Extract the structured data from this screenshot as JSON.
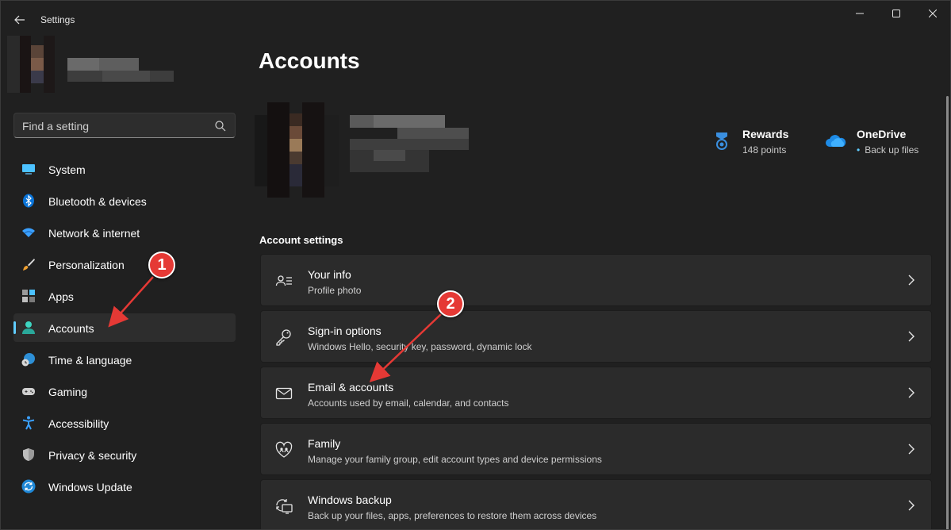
{
  "window": {
    "title": "Settings",
    "back_icon": "back-arrow-icon",
    "controls": [
      "minimize-icon",
      "maximize-icon",
      "close-icon"
    ]
  },
  "search": {
    "placeholder": "Find a setting",
    "icon": "search-icon"
  },
  "sidebar": {
    "items": [
      {
        "label": "System",
        "icon": "system-icon",
        "active": false
      },
      {
        "label": "Bluetooth & devices",
        "icon": "bluetooth-icon",
        "active": false
      },
      {
        "label": "Network & internet",
        "icon": "wifi-icon",
        "active": false
      },
      {
        "label": "Personalization",
        "icon": "brush-icon",
        "active": false
      },
      {
        "label": "Apps",
        "icon": "apps-icon",
        "active": false
      },
      {
        "label": "Accounts",
        "icon": "person-icon",
        "active": true
      },
      {
        "label": "Time & language",
        "icon": "globe-clock-icon",
        "active": false
      },
      {
        "label": "Gaming",
        "icon": "gamepad-icon",
        "active": false
      },
      {
        "label": "Accessibility",
        "icon": "accessibility-icon",
        "active": false
      },
      {
        "label": "Privacy & security",
        "icon": "shield-icon",
        "active": false
      },
      {
        "label": "Windows Update",
        "icon": "update-icon",
        "active": false
      }
    ]
  },
  "main": {
    "title": "Accounts",
    "rewards": {
      "title": "Rewards",
      "subtitle": "148 points",
      "icon": "rewards-medal-icon"
    },
    "onedrive": {
      "title": "OneDrive",
      "subtitle": "Back up files",
      "icon": "cloud-icon"
    },
    "section_title": "Account settings",
    "cards": [
      {
        "title": "Your info",
        "subtitle": "Profile photo",
        "icon": "person-card-icon"
      },
      {
        "title": "Sign-in options",
        "subtitle": "Windows Hello, security key, password, dynamic lock",
        "icon": "key-icon"
      },
      {
        "title": "Email & accounts",
        "subtitle": "Accounts used by email, calendar, and contacts",
        "icon": "mail-icon"
      },
      {
        "title": "Family",
        "subtitle": "Manage your family group, edit account types and device permissions",
        "icon": "family-heart-icon"
      },
      {
        "title": "Windows backup",
        "subtitle": "Back up your files, apps, preferences to restore them across devices",
        "icon": "backup-icon"
      }
    ]
  },
  "annotations": [
    {
      "label": "1"
    },
    {
      "label": "2"
    }
  ],
  "colors": {
    "background": "#202020",
    "card": "#2b2b2b",
    "accent": "#60cdff",
    "marker": "#e53935"
  }
}
